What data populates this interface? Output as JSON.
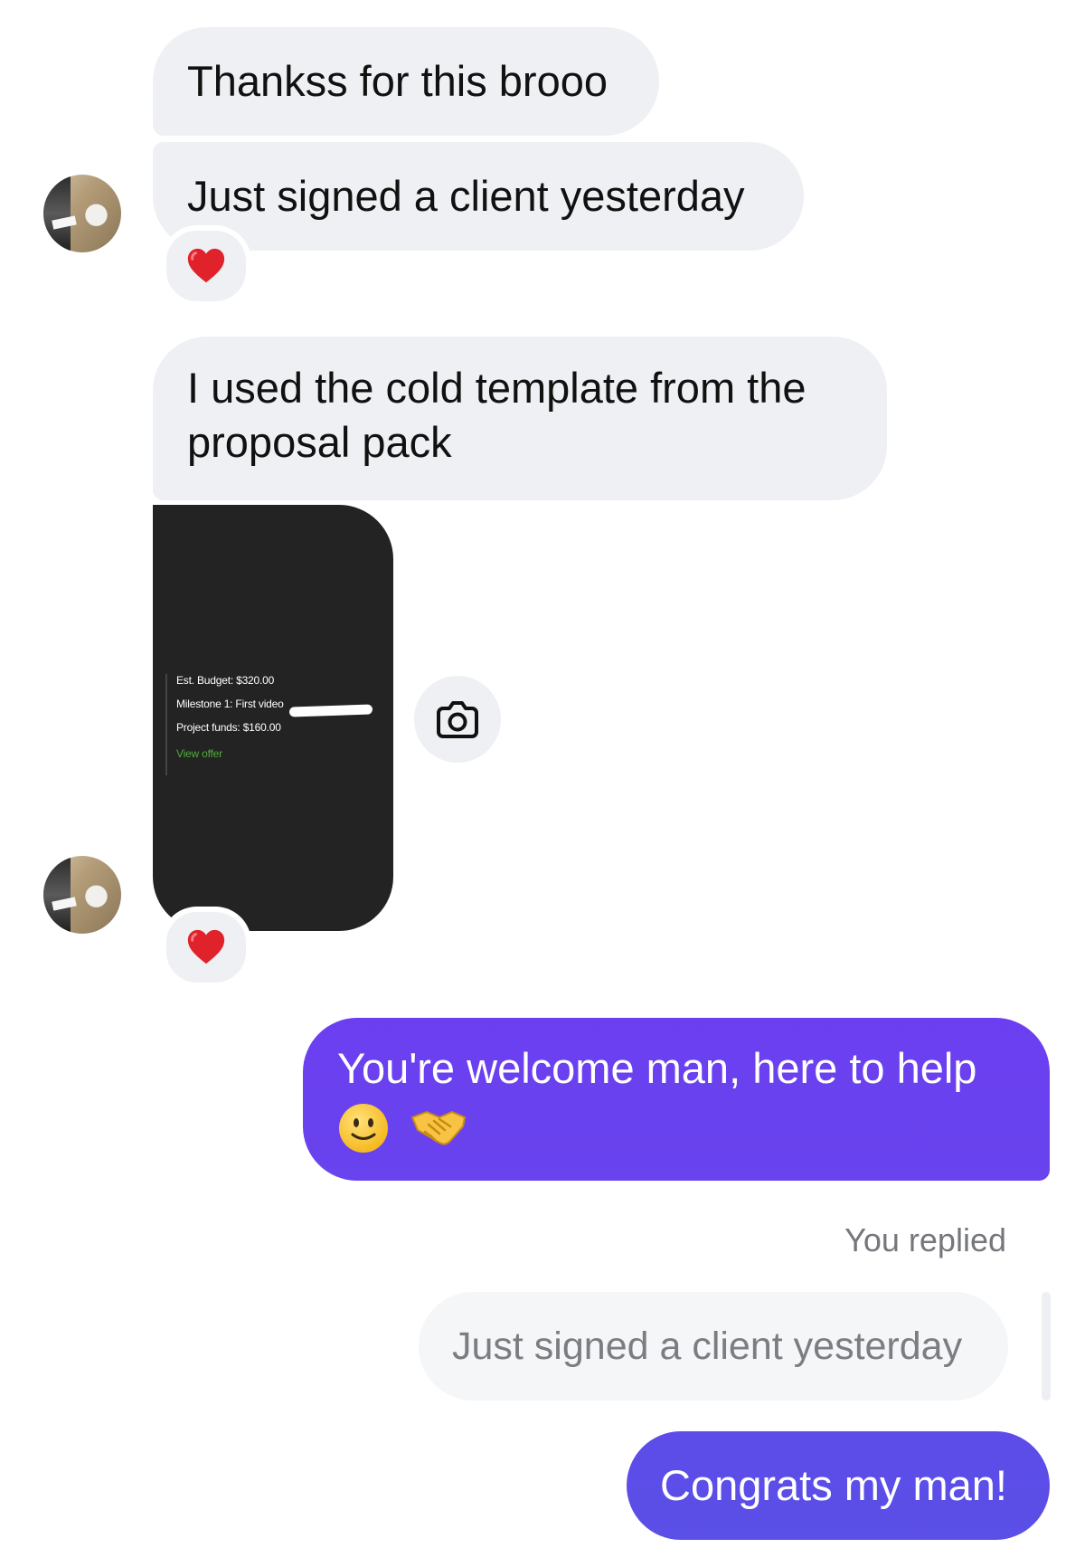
{
  "colors": {
    "incoming_bubble": "#eff0f3",
    "outgoing_gradient_start": "#6b3ff0",
    "outgoing_gradient_end": "#5b4fe8",
    "offer_link": "#4caf3a"
  },
  "conversation": {
    "messages": [
      {
        "id": "m1",
        "from": "them",
        "text": "Thankss for this brooo"
      },
      {
        "id": "m2",
        "from": "them",
        "text": "Just signed a client yesterday",
        "reaction": "red-heart"
      },
      {
        "id": "m3",
        "from": "them",
        "text": "I used the cold template from the proposal pack"
      },
      {
        "id": "m4",
        "from": "them",
        "type": "image",
        "reaction": "red-heart",
        "image_lines": {
          "budget": "Est. Budget: $320.00",
          "milestone": "Milestone 1: First video",
          "funds": "Project funds: $160.00",
          "link": "View offer"
        }
      },
      {
        "id": "m5",
        "from": "me",
        "text": "You're welcome man, here to help",
        "emojis": [
          "slightly-smiling-face",
          "handshake"
        ]
      },
      {
        "id": "m6",
        "from": "me",
        "text": "Congrats my man!",
        "reply_label": "You replied",
        "reply_quote": "Just signed a client yesterday"
      }
    ]
  },
  "icons": {
    "camera": "camera-icon",
    "heart": "red-heart-icon"
  }
}
